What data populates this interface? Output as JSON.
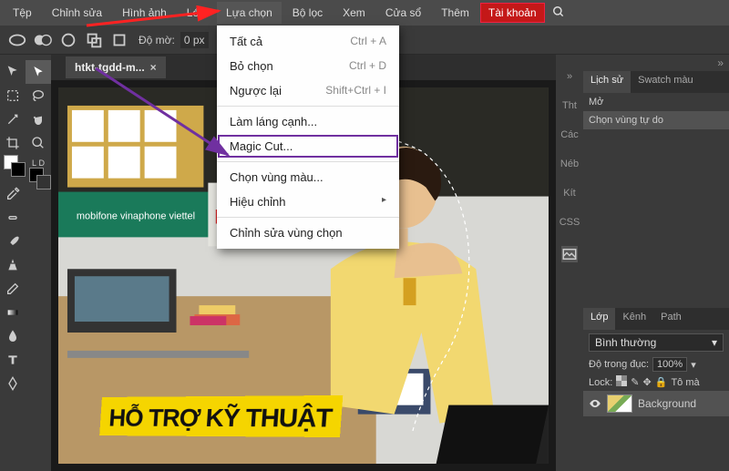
{
  "menubar": {
    "items": [
      "Tệp",
      "Chỉnh sửa",
      "Hình ảnh",
      "Lớp",
      "Lựa chọn",
      "Bộ lọc",
      "Xem",
      "Cửa sổ",
      "Thêm"
    ],
    "account": "Tài khoản"
  },
  "optionsbar": {
    "opacity_label": "Độ mờ:",
    "opacity_value": "0 px"
  },
  "doc_tab": {
    "title": "htkt-tgdd-m...",
    "close": "×"
  },
  "dropdown": {
    "items": [
      {
        "label": "Tất cả",
        "shortcut": "Ctrl + A"
      },
      {
        "label": "Bỏ chọn",
        "shortcut": "Ctrl + D"
      },
      {
        "label": "Ngược lại",
        "shortcut": "Shift+Ctrl + I"
      },
      {
        "sep": true
      },
      {
        "label": "Làm láng cạnh..."
      },
      {
        "label": "Magic Cut...",
        "highlight": true
      },
      {
        "sep": true
      },
      {
        "label": "Chọn vùng màu..."
      },
      {
        "label": "Hiệu chỉnh",
        "sub": true
      },
      {
        "sep": true
      },
      {
        "label": "Chỉnh sửa vùng chọn"
      }
    ]
  },
  "rpanel_mini": [
    "Tht",
    "Các",
    "Néb",
    "Kít",
    "CSS"
  ],
  "history": {
    "tabs": [
      "Lịch sử",
      "Swatch màu"
    ],
    "items": [
      "Mở",
      "Chọn vùng tự do"
    ]
  },
  "layers": {
    "tabs": [
      "Lớp",
      "Kênh",
      "Path"
    ],
    "blend": "Bình thường",
    "opacity_label": "Độ trong đục:",
    "opacity_value": "100%",
    "lock_label": "Lock:",
    "fill_label": "Tô mà",
    "items": [
      "Background"
    ]
  },
  "photo": {
    "sign_text": "HỖ TRỢ KỸ THUẬT"
  }
}
